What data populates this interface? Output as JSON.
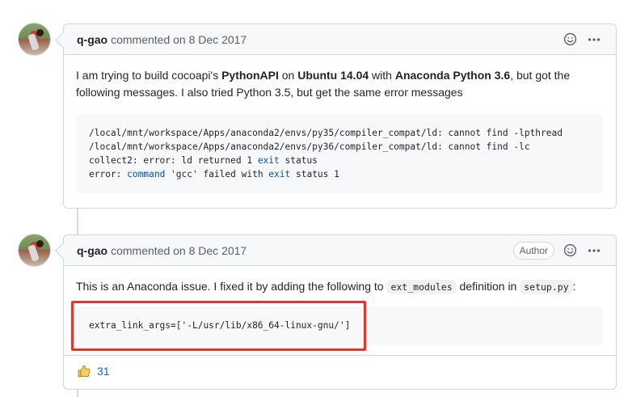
{
  "comments": [
    {
      "author": "q-gao",
      "meta": "commented on 8 Dec 2017",
      "body_parts": [
        "I am trying to build cocoapi's ",
        "PythonAPI",
        " on ",
        "Ubuntu 14.04",
        " with ",
        "Anaconda Python 3.6",
        ", but got the following messages. I also tried Python 3.5, but get the same error messages"
      ],
      "code_lines": [
        "/local/mnt/workspace/Apps/anaconda2/envs/py35/compiler_compat/ld: cannot find -lpthread",
        "/local/mnt/workspace/Apps/anaconda2/envs/py36/compiler_compat/ld: cannot find -lc",
        "collect2: error: ld returned 1 ",
        "exit",
        " status",
        "error: ",
        "command",
        " 'gcc' failed with ",
        "exit",
        " status 1"
      ]
    },
    {
      "author": "q-gao",
      "meta": "commented on 8 Dec 2017",
      "badge": "Author",
      "body_parts": [
        "This is an Anaconda issue. I fixed it by adding the following to ",
        "ext_modules",
        " definition in ",
        "setup.py",
        ":"
      ],
      "code": "extra_link_args=['-L/usr/lib/x86_64-linux-gnu/']",
      "reactions": [
        {
          "icon": "thumbs-up-icon",
          "count": "31"
        }
      ]
    }
  ],
  "colors": {
    "accent": "#0969da",
    "highlight": "#e3342f",
    "border": "#d0d7de"
  }
}
